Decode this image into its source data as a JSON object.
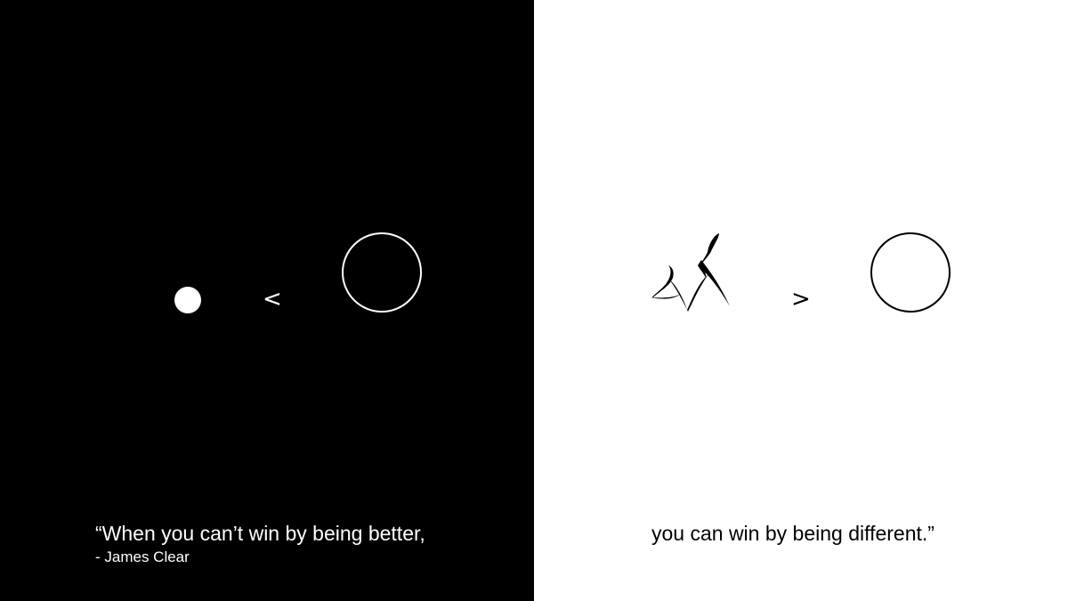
{
  "colors": {
    "left_background": "#000000",
    "left_foreground": "#ffffff",
    "right_background": "#ffffff",
    "right_foreground": "#000000"
  },
  "left_panel": {
    "operator": "<",
    "quote": "“When you can’t win by being better,",
    "author": "- James Clear"
  },
  "right_panel": {
    "operator": ">",
    "quote": "you can win by being different.”"
  },
  "icons": {
    "left_small": "filled-dot-icon",
    "left_large": "outline-circle-icon",
    "right_small": "abstract-scribble-icon",
    "right_large": "outline-circle-icon"
  }
}
